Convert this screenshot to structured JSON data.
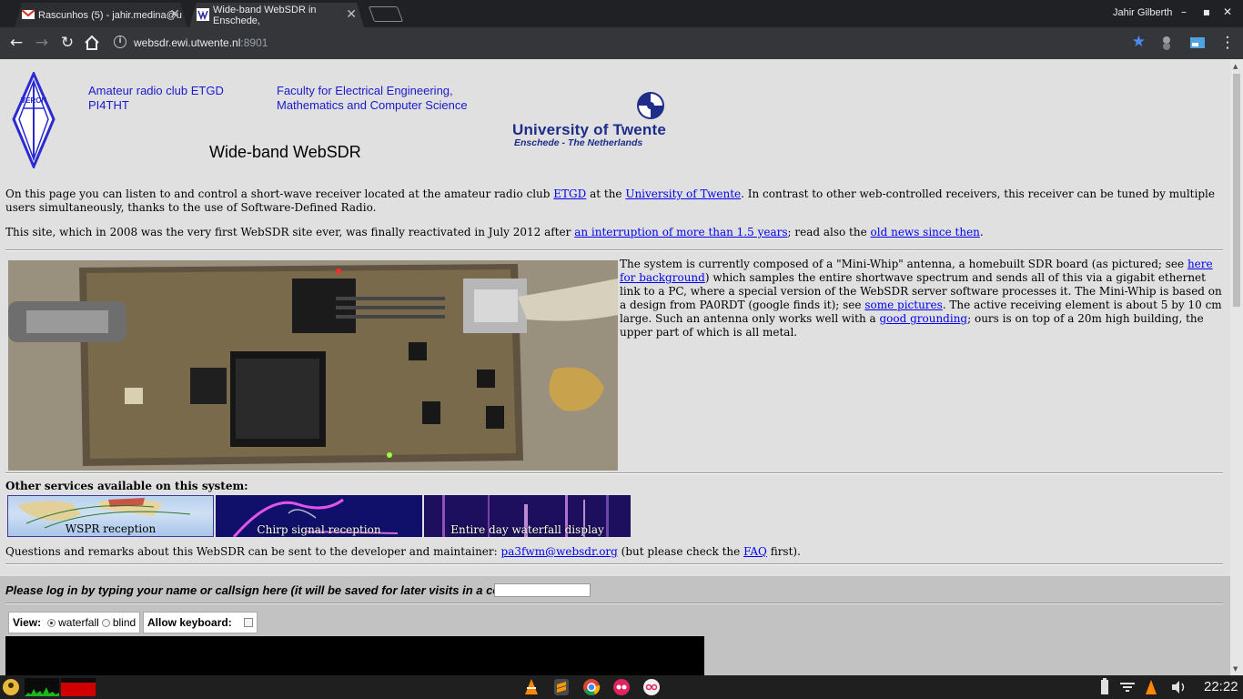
{
  "browser": {
    "tabs": [
      {
        "title": "Rascunhos (5) - jahir.medina@u",
        "close": "✕"
      },
      {
        "title": "Wide-band WebSDR in Enschede,",
        "close": "✕"
      }
    ],
    "user": "Jahir Gilberth",
    "window_controls": {
      "minimize": "–",
      "maximize": "▪",
      "close": "✕"
    },
    "url_host": "websdr.ewi.utwente.nl",
    "url_port": ":8901",
    "accent": "#4c8bf5"
  },
  "header": {
    "club_line1": "Amateur radio club ETGD",
    "club_line2": "PI4THT",
    "faculty_line1": "Faculty for Electrical Engineering,",
    "faculty_line2": "Mathematics and Computer Science",
    "title": "Wide-band WebSDR",
    "veron_logo_text": "VERON",
    "ut_name": "University of Twente",
    "ut_sub": "Enschede - The Netherlands"
  },
  "intro": {
    "p1_a": "On this page you can listen to and control a short-wave receiver located at the amateur radio club ",
    "p1_link1": "ETGD",
    "p1_b": " at the ",
    "p1_link2": "University of Twente",
    "p1_c": ". In contrast to other web-controlled receivers, this receiver can be tuned by multiple users simultaneously, thanks to the use of Software-Defined Radio.",
    "p2_a": "This site, which in 2008 was the very first WebSDR site ever, was finally reactivated in July 2012 after ",
    "p2_link1": "an interruption of more than 1.5 years",
    "p2_b": "; read also the ",
    "p2_link2": "old news since then",
    "p2_c": "."
  },
  "description": {
    "a": "The system is currently composed of a \"Mini-Whip\" antenna, a homebuilt SDR board (as pictured; see ",
    "link1": "here for background",
    "b": ") which samples the entire shortwave spectrum and sends all of this via a gigabit ethernet link to a PC, where a special version of the WebSDR server software processes it. The Mini-Whip is based on a design from PA0RDT (google finds it); see ",
    "link2": "some pictures",
    "c": ". The active receiving element is about 5 by 10 cm large. Such an antenna only works well with a ",
    "link3": "good grounding",
    "d": "; ours is on top of a 20m high building, the upper part of which is all metal."
  },
  "services": {
    "heading": "Other services available on this system:",
    "items": [
      "WSPR reception",
      "Chirp signal reception",
      "Entire day waterfall display"
    ]
  },
  "contact": {
    "a": "Questions and remarks about this WebSDR can be sent to the developer and maintainer: ",
    "email": "pa3fwm@websdr.org",
    "b": " (but please check the ",
    "faq": "FAQ",
    "c": " first)."
  },
  "login": {
    "prompt": "Please log in by typing your name or callsign here (it will be saved for later visits in a cookie):",
    "value": ""
  },
  "view": {
    "label": "View:",
    "options": [
      "waterfall",
      "blind"
    ],
    "selected": "waterfall",
    "keyboard_label": "Allow keyboard:",
    "keyboard_checked": false
  },
  "taskbar": {
    "clock": "22:22"
  }
}
